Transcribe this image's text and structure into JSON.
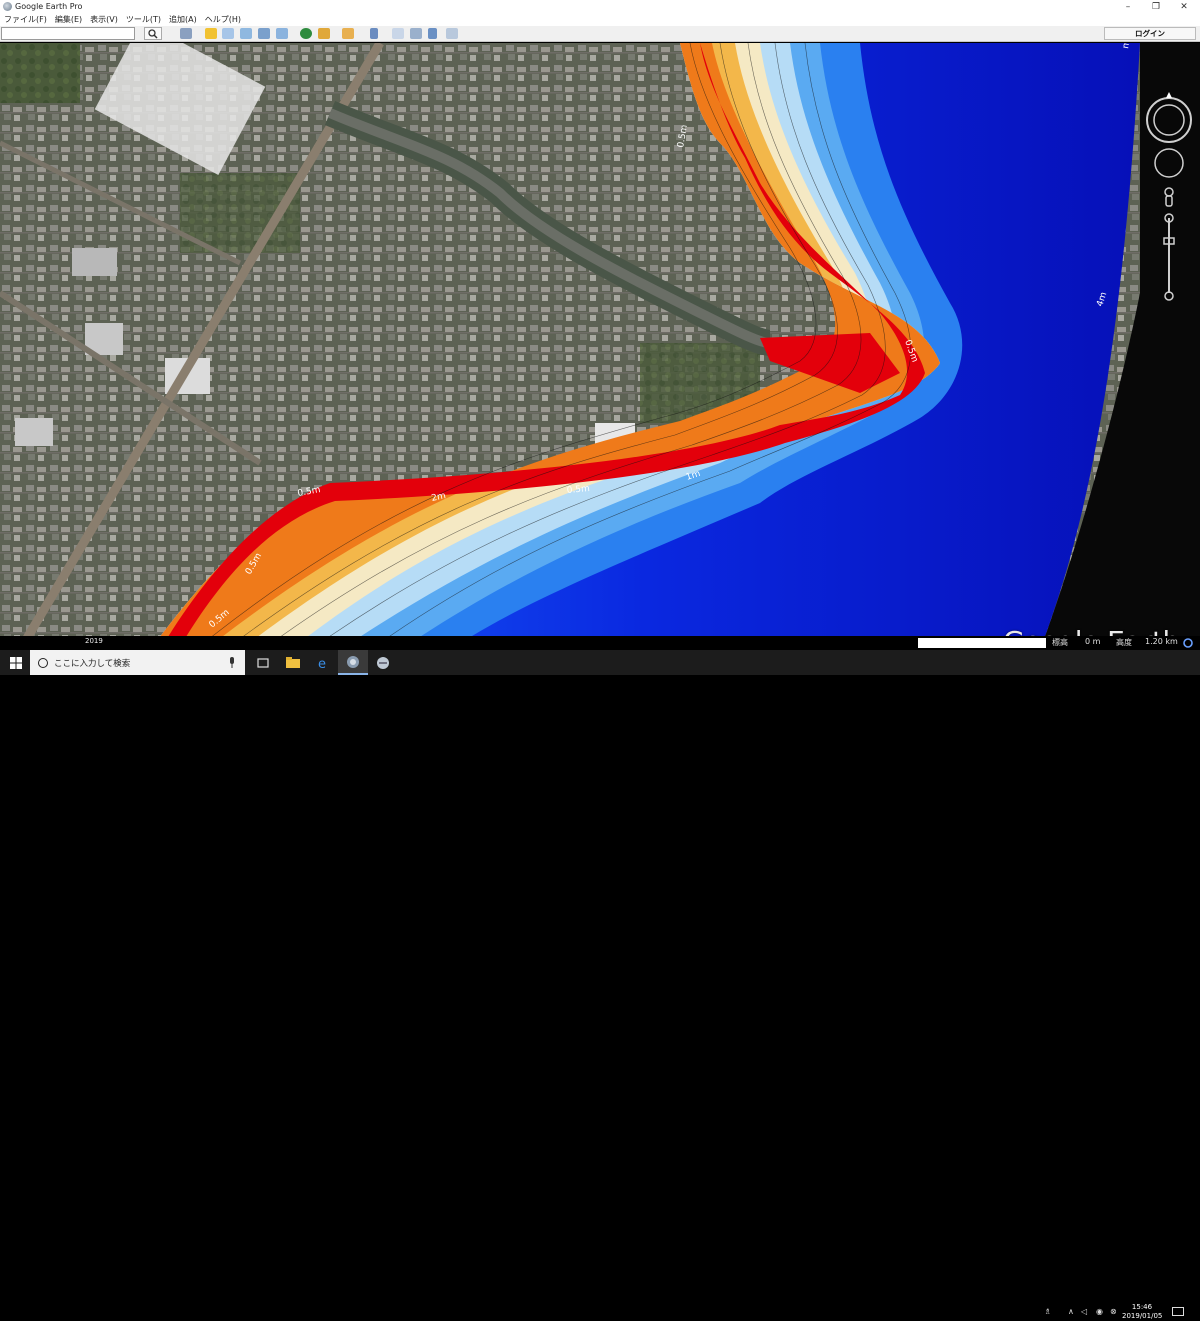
{
  "window": {
    "title": "Google Earth Pro",
    "minimize": "–",
    "maximize": "❐",
    "close": "✕"
  },
  "menu": [
    "ファイル(F)",
    "編集(E)",
    "表示(V)",
    "ツール(T)",
    "追加(A)",
    "ヘルプ(H)"
  ],
  "toolbar": {
    "search_value": "",
    "login_label": "ログイン"
  },
  "map": {
    "contour_labels": [
      "0.5m",
      "0.5m",
      "0.5m",
      "0.5m",
      "0.5m",
      "2m",
      "0.5m",
      "1m",
      "0.5m",
      "4m",
      "m"
    ],
    "logo": "Google Earth",
    "imagery_year": "2019"
  },
  "status": {
    "elevation_label": "標高",
    "elevation_value": "0 m",
    "altitude_label": "高度",
    "altitude_value": "1.20 km"
  },
  "taskbar": {
    "search_placeholder": "ここに入力して検索",
    "time": "15:46",
    "date": "2019/01/05"
  },
  "colors": {
    "deep_blue": "#0a18d8",
    "red": "#e3000b",
    "orange": "#f08a1a",
    "pale": "#f5e9c4"
  }
}
